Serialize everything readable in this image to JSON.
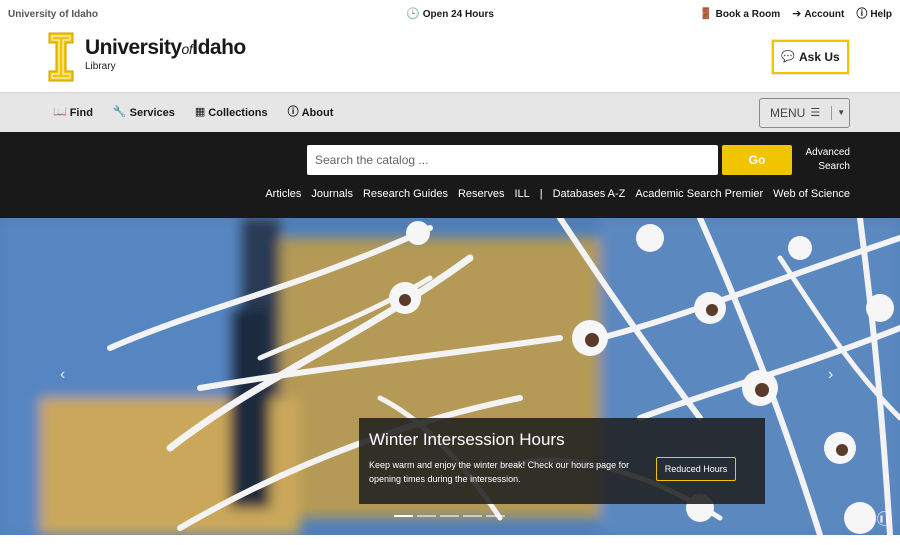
{
  "topbar": {
    "site_name": "University of Idaho",
    "hours": "Open 24 Hours",
    "book_room": "Book a Room",
    "account": "Account",
    "help": "Help"
  },
  "header": {
    "logo_main": "University",
    "logo_of": "of",
    "logo_idaho": "Idaho",
    "logo_sub": "Library",
    "ask_us": "Ask Us"
  },
  "nav": {
    "items": [
      "Find",
      "Services",
      "Collections",
      "About"
    ],
    "menu_label": "MENU"
  },
  "search": {
    "placeholder": "Search the catalog ...",
    "go": "Go",
    "advanced_1": "Advanced",
    "advanced_2": "Search",
    "links": [
      "Articles",
      "Journals",
      "Research Guides",
      "Reserves",
      "ILL",
      "|",
      "Databases A-Z",
      "Academic Search Premier",
      "Web of Science"
    ]
  },
  "hero": {
    "title": "Winter Intersession Hours",
    "body": "Keep warm and enjoy the winter break! Check our hours page for opening times during the intersession.",
    "button": "Reduced Hours",
    "prev": "‹",
    "next": "›",
    "pause": "❚❚"
  },
  "colors": {
    "accent": "#f1c400",
    "dark": "#191919",
    "nav_bg": "#e6e6e6"
  }
}
